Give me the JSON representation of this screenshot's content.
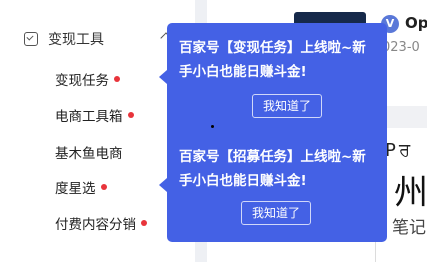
{
  "sidebar": {
    "section": {
      "title": "变现工具",
      "icon": "checkbox-icon",
      "chevron": "chevron-up-icon"
    },
    "items": [
      {
        "label": "变现任务",
        "badge": true
      },
      {
        "label": "电商工具箱",
        "badge": true
      },
      {
        "label": "基木鱼电商",
        "badge": false
      },
      {
        "label": "度星选",
        "badge": true
      },
      {
        "label": "付费内容分销",
        "badge": true
      }
    ]
  },
  "content": {
    "source_badge": "V",
    "source_name": "Op",
    "date": "023-0",
    "fragment_a": "P",
    "fragment_b": "ਰ",
    "big_char": "州",
    "small_text": "笔记"
  },
  "popups": [
    {
      "text": "百家号【变现任务】上线啦~新手小白也能日赚斗金!",
      "button": "我知道了"
    },
    {
      "text": "百家号【招募任务】上线啦~新手小白也能日赚斗金!",
      "button": "我知道了"
    }
  ],
  "colors": {
    "popup": "#4461e5",
    "badge": "#e8343b",
    "strip": "#eef0f4"
  }
}
